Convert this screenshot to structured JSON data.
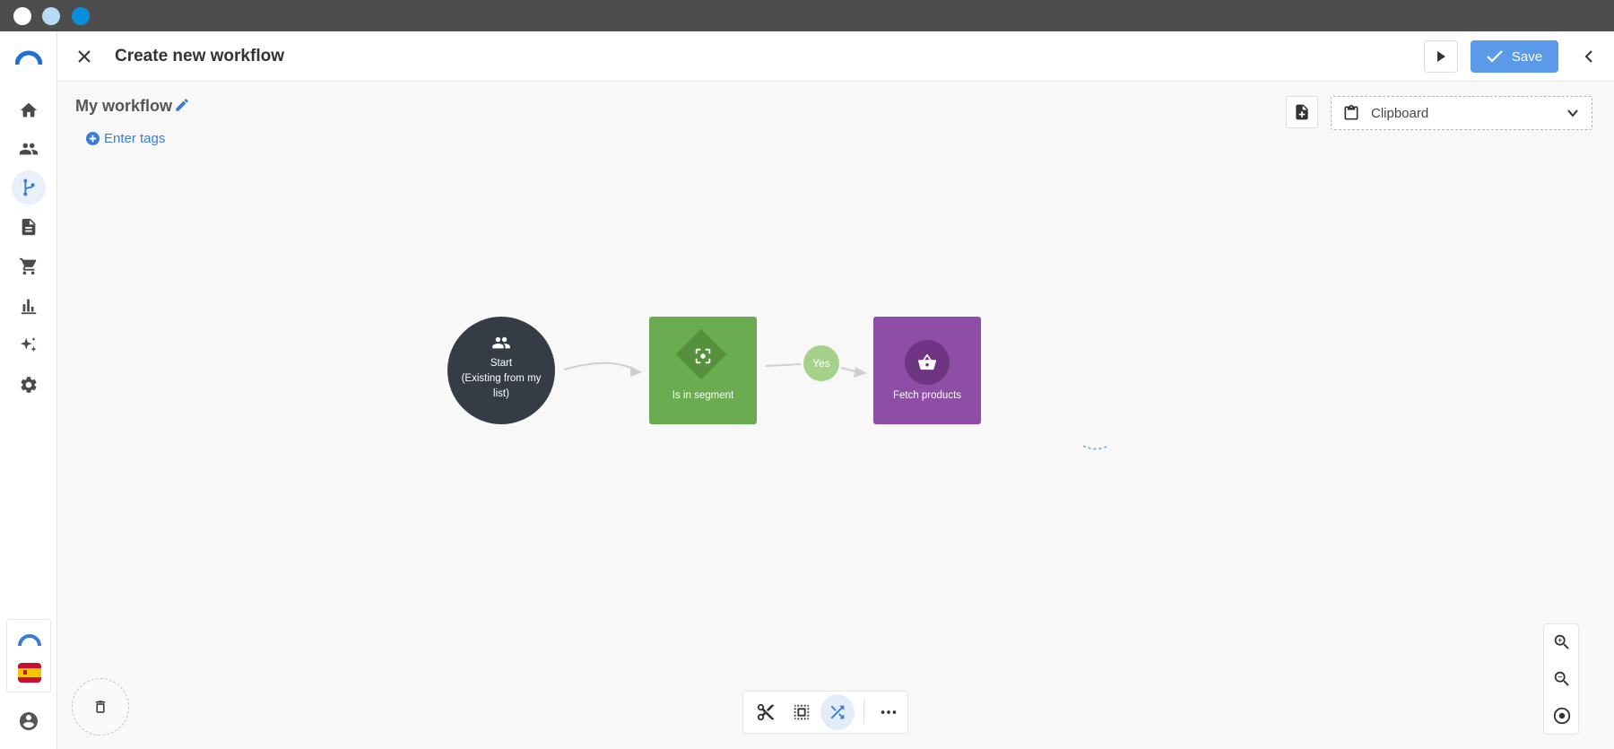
{
  "header": {
    "title": "Create new workflow",
    "save_label": "Save"
  },
  "workflow": {
    "name": "My workflow",
    "tags_label": "Enter tags"
  },
  "clipboard": {
    "label": "Clipboard"
  },
  "nodes": {
    "start": {
      "line1": "Start",
      "line2": "(Existing from my",
      "line3": "list)"
    },
    "segment": {
      "label": "Is in segment"
    },
    "branch": {
      "label": "Yes"
    },
    "fetch": {
      "label": "Fetch products"
    }
  },
  "sidebar": {
    "items": [
      "home-icon",
      "contacts-icon",
      "workflow-icon",
      "document-icon",
      "cart-icon",
      "chart-icon",
      "sparkle-icon",
      "settings-icon"
    ],
    "active": "workflow-icon"
  },
  "colors": {
    "accent": "#5b9ae8",
    "start_node": "#353c45",
    "segment_node": "#6aac4f",
    "fetch_node": "#8e4ea5",
    "yes_badge": "#a5d28a"
  }
}
